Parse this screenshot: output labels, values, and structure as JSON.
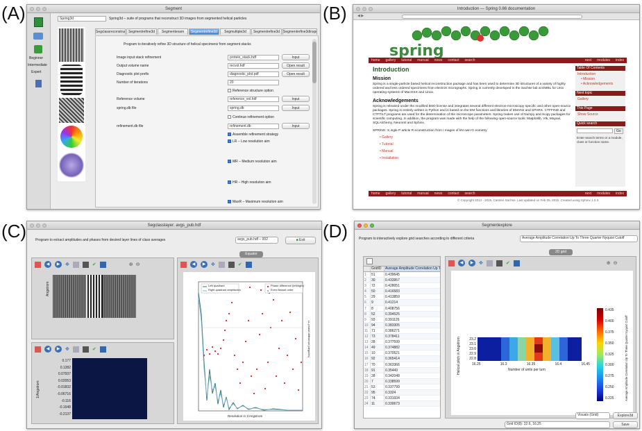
{
  "labels": {
    "a": "(A)",
    "b": "(B)",
    "c": "(C)",
    "d": "(D)"
  },
  "panelA": {
    "window_title": "Segment",
    "program_select": "Spring3d",
    "program_desc": "Spring3d – suite of programs that reconstruct 3D images from segmented helical particles",
    "sidebar": [
      "Beginner",
      "Intermediate",
      "Expert"
    ],
    "tabs": [
      "Segclassreconstruct",
      "Segmentrefine3d",
      "Segmentexam",
      "Segmentrefine3d",
      "Segmultiple3d",
      "Segmentrefine3d",
      "Segmentrefine3dinspect"
    ],
    "heading": "Program to iteratively refine 3D structure of helical specimens from segment stacks",
    "params": [
      {
        "label": "Image input stack refinement",
        "value": "protein_stack.hdf",
        "btn": "Input"
      },
      {
        "label": "Output volume name",
        "value": "recvol.hdf",
        "btn": "Open result"
      },
      {
        "label": "Diagnostic plot prefix",
        "value": "diagnostic_plot.pdf",
        "btn": "Open result"
      },
      {
        "label": "Number of iterations",
        "value": "20",
        "btn": ""
      },
      {
        "label": "",
        "value": "Reference structure option",
        "btn": ""
      },
      {
        "label": "Reference volume",
        "value": "reference_vol.hdf",
        "btn": "Input"
      },
      {
        "label": "spring.db file",
        "value": "spring.db",
        "btn": "Input"
      },
      {
        "label": "",
        "value": "Continue refinement option",
        "btn": ""
      },
      {
        "label": "refinement.db file",
        "value": "refinement.db",
        "btn": "Input"
      }
    ],
    "checks": [
      "Assemble refinement strategy",
      "LR – Low resolution aim",
      "MR – Medium resolution aim",
      "HR – High resolution aim",
      "MaxR – Maximum resolution aim"
    ]
  },
  "panelB": {
    "window_title": "Introduction — Spring 0.86 documentation",
    "brand": "spring",
    "nav_left": [
      "home",
      "gallery",
      "tutorial",
      "manual",
      "news",
      "contact",
      "search"
    ],
    "nav_right": [
      "next",
      "modules",
      "index"
    ],
    "h1": "Introduction",
    "h2a": "Mission",
    "mission": "Spring is a single-particle based helical reconstruction package and has been used to determine 3D structures of a variety of highly ordered and less ordered specimens from electron micrographs. Spring is currently developed in the Sachse lab at EMBL for Unix operating systems of MacOSX and Linux.",
    "h2b": "Acknowledgements",
    "ack": "Spring is released under the modified BSD license and integrates several different electron-microscopy specific and other open-source packages. Spring is entirely written in Python and is based on the EM functions and libraries of EMAN2 and SPARX. CTFFIND and CTFTILT programs are used for the determination of the microscope parameters. Spring makes use of Numpy and Scipy packages for scientific computing. In addition, the program was made with the help of the following open-source tools: Matplotlib, Vtk, Mayavi, SQLAlchemy, Neuroml and Sphinx.",
    "spring_line": "SPRING: S ingle P article R econstruction from I mages of kN own G eometry",
    "bullets": [
      "Gallery",
      "Tutorial",
      "Manual",
      "Installation"
    ],
    "toc_title": "Table Of Contents",
    "toc": [
      "Introduction",
      "Mission",
      "Acknowledgements"
    ],
    "side_heads": [
      "Next topic",
      "This Page",
      "Quick search"
    ],
    "side_links": [
      "Gallery",
      "Show Source"
    ],
    "go": "Go",
    "search_hint": "Enter search terms or a module, class or function name.",
    "footer": "© Copyright 2013 - 2015, Carsten Sachse. Last updated on Feb 05, 2015. Created using Sphinx 1.2.3."
  },
  "panelC": {
    "window_title": "Segclasslayer: avgs_pub.hdf",
    "desc": "Program to extract amplitudes and phases from desired layer lines of class averages",
    "select": "avgs_pub.hdf – 002",
    "exit": "Exit",
    "tab": "Equator",
    "top_ylabel": "Angstrom",
    "bot_ylabel": "1/Angstrom",
    "bot_ticks": [
      "0.177",
      "0.1282",
      "0.07937",
      "0.02053",
      "-0.01832",
      "-0.06716",
      "-0.116",
      "-0.1648",
      "-0.2137"
    ],
    "right_legend_l": [
      "Left quadrant",
      "Right quadrant amplitudes"
    ],
    "right_legend_r": [
      "Phase difference (left/right)",
      "Even Bessel order"
    ],
    "right_xlabel": "Resolution in 1/Angstrom",
    "right_ylabel": "LL phase difference (degrees)"
  },
  "panelD": {
    "window_title": "Segmentexplore",
    "desc": "Program to interactively explore grid searches according to different criteria",
    "criterion": "Average Amplitude Correlation Up To Three Quarter Nyquist Cutoff",
    "exit": "Exit",
    "tab": "2D grid",
    "col_headers": [
      "GridID",
      "Average Amplitude Correlation Up To"
    ],
    "rows": [
      [
        "1",
        "51",
        "0.439645"
      ],
      [
        "2",
        "30",
        "0.433957"
      ],
      [
        "3",
        "72",
        "0.428051"
      ],
      [
        "4",
        "50",
        "0.416583"
      ],
      [
        "5",
        "29",
        "0.413859"
      ],
      [
        "6",
        "9",
        "0.41214"
      ],
      [
        "7",
        "8",
        "0.408756"
      ],
      [
        "8",
        "52",
        "0.394525"
      ],
      [
        "9",
        "93",
        "0.391126"
      ],
      [
        "10",
        "94",
        "0.383305"
      ],
      [
        "11",
        "71",
        "0.386271"
      ],
      [
        "12",
        "73",
        "0.378411"
      ],
      [
        "13",
        "28",
        "0.377599"
      ],
      [
        "14",
        "49",
        "0.374882"
      ],
      [
        "15",
        "10",
        "0.370521"
      ],
      [
        "16",
        "92",
        "0.365414"
      ],
      [
        "17",
        "70",
        "0.363366"
      ],
      [
        "18",
        "91",
        "0.35443"
      ],
      [
        "19",
        "28",
        "0.342048"
      ],
      [
        "20",
        "7",
        "0.338599"
      ],
      [
        "21",
        "53",
        "0.337799"
      ],
      [
        "22",
        "95",
        "0.3324"
      ],
      [
        "23",
        "74",
        "0.331934"
      ],
      [
        "24",
        "11",
        "0.330673"
      ]
    ],
    "xlabel": "Number of units per turn",
    "ylabel": "Helical pitch in Angstrom",
    "xticks": [
      "16.25",
      "16.3",
      "16.35",
      "16.4",
      "16.45"
    ],
    "yticks": [
      "23.2",
      "23.1",
      "23.0",
      "22.9",
      "22.8"
    ],
    "cbar_ticks": [
      "0.435",
      "0.400",
      "0.375",
      "0.350",
      "0.325",
      "0.300",
      "0.275",
      "0.250",
      "0.225"
    ],
    "cbar_label": "Average Amplitude Correlation Up To Three Quarter Nyquist Cutoff",
    "vis_select": "Visuals (Grid)",
    "explore_btn": "Explore3d",
    "grid_select": "Grid ID(8): 22.6, 16.25",
    "save": "Save"
  }
}
